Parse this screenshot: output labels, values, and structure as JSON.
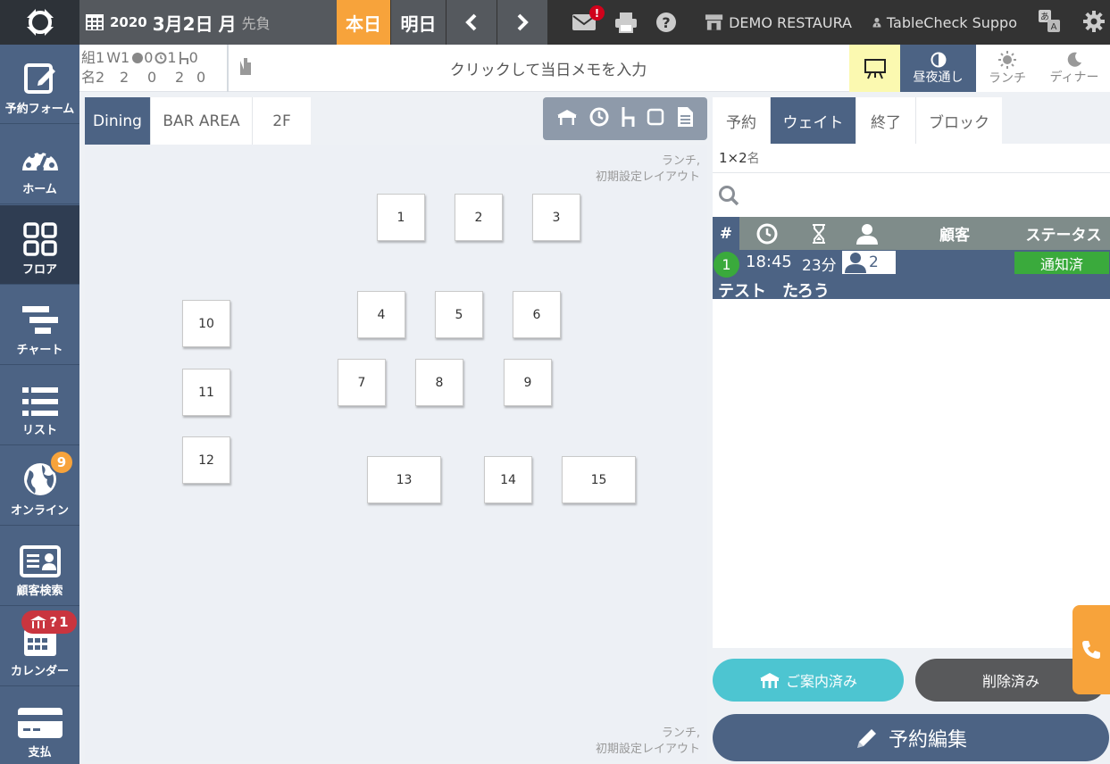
{
  "topbar": {
    "year": "2020",
    "date": "3月2日",
    "dow": "月",
    "rokuyo": "先負",
    "today_label": "本日",
    "tomorrow_label": "明日",
    "restaurant_name": "DEMO RESTAURA",
    "support_name": "TableCheck Suppo",
    "mail_alert": "!"
  },
  "sidebar": {
    "items": [
      {
        "label": "予約フォーム"
      },
      {
        "label": "ホーム"
      },
      {
        "label": "フロア"
      },
      {
        "label": "チャート"
      },
      {
        "label": "リスト"
      },
      {
        "label": "オンライン",
        "badge": "9"
      },
      {
        "label": "顧客検索"
      },
      {
        "label": "カレンダー",
        "badge": "1",
        "badge_prefix": "?"
      },
      {
        "label": "支払"
      }
    ]
  },
  "counts": {
    "groups_label": "組",
    "people_label": "名",
    "row1": [
      "1",
      "1",
      "0",
      "1",
      "0"
    ],
    "w_label": "W",
    "row2": [
      "2",
      "2",
      "0",
      "2",
      "0"
    ]
  },
  "memo": {
    "placeholder": "クリックして当日メモを入力"
  },
  "views": {
    "allday": "昼夜通し",
    "lunch": "ランチ",
    "dinner": "ディナー"
  },
  "floor": {
    "tabs": [
      "Dining",
      "BAR AREA",
      "2F"
    ],
    "layout_note_line1": "ランチ,",
    "layout_note_line2": "初期設定レイアウト",
    "tables": [
      "1",
      "2",
      "3",
      "4",
      "5",
      "6",
      "7",
      "8",
      "9",
      "10",
      "11",
      "12",
      "13",
      "14",
      "15"
    ]
  },
  "right": {
    "tabs": [
      "予約",
      "ウェイト",
      "終了",
      "ブロック"
    ],
    "summary_count": "1×2",
    "summary_unit": "名",
    "header_hash": "#",
    "header_customer": "顧客",
    "header_status": "ステータス",
    "reservation": {
      "num": "1",
      "time": "18:45",
      "duration": "23分",
      "party": "2",
      "status": "通知済",
      "name": "テスト　たろう"
    },
    "seated_label": "ご案内済み",
    "deleted_label": "削除済み",
    "edit_label": "予約編集"
  },
  "colors": {
    "primary": "#4c6384",
    "accent": "#f7a33b",
    "success": "#3aaa3c",
    "teal": "#4dc5d1"
  }
}
